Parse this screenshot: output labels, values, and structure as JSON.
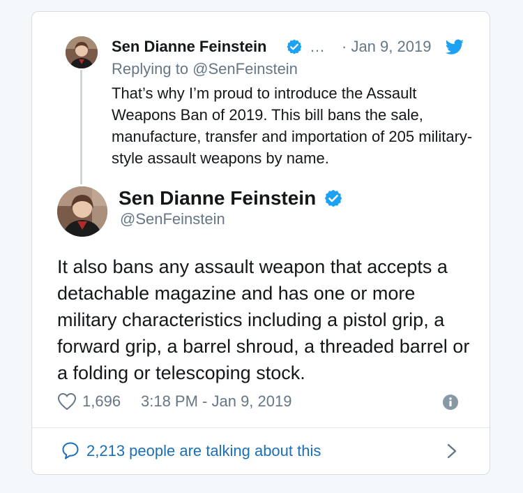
{
  "parent_tweet": {
    "name": "Sen Dianne Feinstein",
    "ellipsis": "…",
    "date": "· Jan 9, 2019",
    "replying_to": "Replying to @SenFeinstein",
    "text": "That’s why I’m proud to introduce the Assault Weapons Ban of 2019. This bill bans the sale, manufacture, transfer and importation of 205 military-style assault weapons by name."
  },
  "main_tweet": {
    "name": "Sen Dianne Feinstein",
    "handle": "@SenFeinstein",
    "text": "It also bans any assault weapon that accepts a detachable magazine and has one or more military characteristics including a pistol grip, a forward grip, a barrel shroud, a threaded barrel or a folding or telescoping stock.",
    "likes": "1,696",
    "timestamp": "3:18 PM - Jan 9, 2019"
  },
  "footer": {
    "talking_text": "2,213 people are talking about this"
  },
  "icons": {
    "verified": "verified-badge-icon",
    "bird": "twitter-bird-icon",
    "heart": "heart-icon",
    "info": "info-icon",
    "bubble": "speech-bubble-icon",
    "chevron": "chevron-right-icon"
  },
  "colors": {
    "accent": "#1da1f2",
    "link": "#1b6fb7",
    "muted": "#657786",
    "text": "#14171a"
  }
}
